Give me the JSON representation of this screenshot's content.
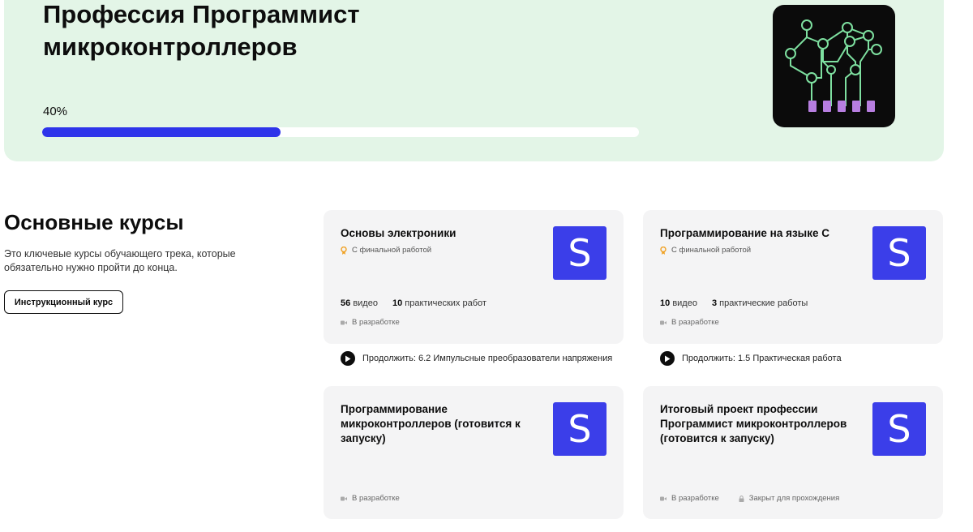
{
  "hero": {
    "title": "Профессия Программист микроконтроллеров",
    "progress_label": "40%",
    "progress_value": 0.4,
    "logo_icon": "circuit-board-icon",
    "accent_color": "#2e34ea",
    "background_color": "#e3f5e7"
  },
  "section": {
    "title": "Основные курсы",
    "description": "Это ключевые курсы обучающего трека, которые обязательно нужно пройти до конца.",
    "button_label": "Инструкционный курс"
  },
  "badge_letter": "S",
  "cards": [
    {
      "title": "Основы электроники",
      "final_work": "С финальной работой",
      "videos_count": "56",
      "videos_label": "видео",
      "works_count": "10",
      "works_label": "практических работ",
      "status": "В разработке",
      "continue": "Продолжить: 6.2 Импульсные преобразователи напряжения"
    },
    {
      "title": "Программирование на языке C",
      "final_work": "С финальной работой",
      "videos_count": "10",
      "videos_label": "видео",
      "works_count": "3",
      "works_label": "практические работы",
      "status": "В разработке",
      "continue": "Продолжить: 1.5 Практическая работа"
    },
    {
      "title": "Программирование микроконтроллеров (готовится к запуску)",
      "status": "В разработке"
    },
    {
      "title": "Итоговый проект профессии Программист микроконтроллеров (готовится к запуску)",
      "status": "В разработке",
      "lock_label": "Закрыт для прохождения"
    }
  ]
}
